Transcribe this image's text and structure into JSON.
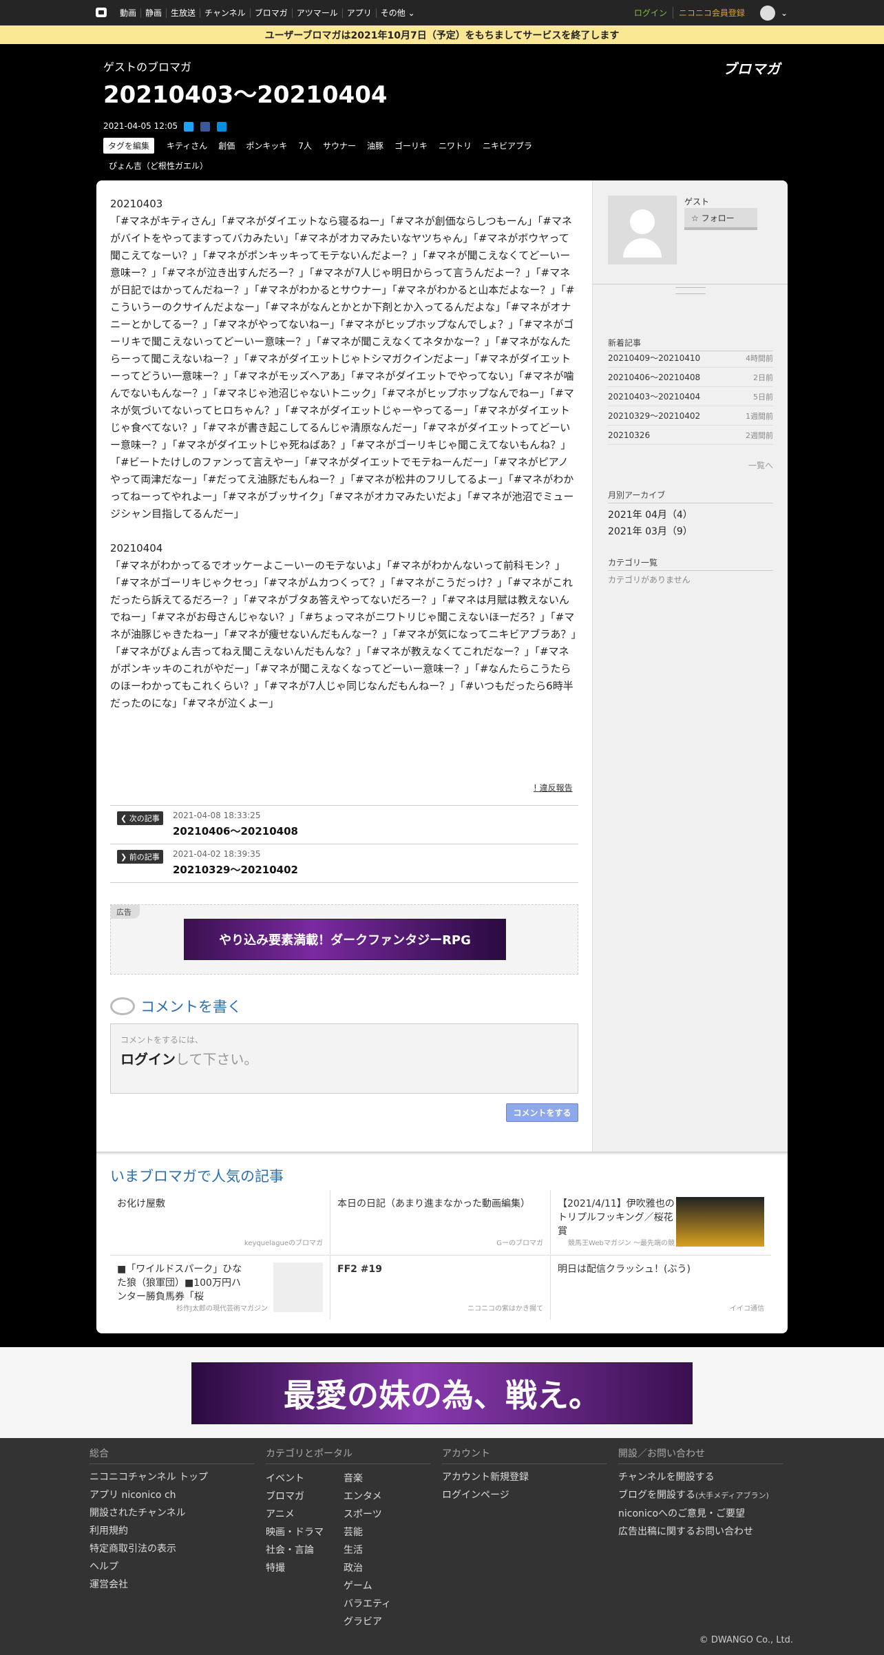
{
  "topbar": {
    "nav": [
      "動画",
      "静画",
      "生放送",
      "チャンネル",
      "ブロマガ",
      "アツマール",
      "アプリ",
      "その他"
    ],
    "login": "ログイン",
    "premium": "ニコニコ会員登録"
  },
  "notice": "ユーザーブロマガは2021年10月7日（予定）をもちましてサービスを終了します",
  "header": {
    "author": "ゲストのブロマガ",
    "title": "20210403～20210404",
    "brand": "ブロマガ",
    "date": "2021-04-05 12:05",
    "edit_tags": "タグを編集",
    "tags": [
      "キティさん",
      "創価",
      "ポンキッキ",
      "7人",
      "サウナー",
      "油豚",
      "ゴーリキ",
      "ニワトリ",
      "ニキビアブラ",
      "ぴょん吉（ど根性ガエル）"
    ]
  },
  "article": {
    "paragraphs": [
      "20210403\n「#マネがキティさん」「#マネがダイエットなら寝るねー」「#マネが創価ならしつもーん」「#マネがバイトをやってますってバカみたい」「#マネがオカマみたいなヤツちゃん」「#マネがボウヤって聞こえてなーい？」「#マネがポンキッキってモテないんだよー？」「#マネが聞こえなくてどーいー意味ー？」「#マネが泣き出すんだろー？」「#マネが7人じゃ明日からって言うんだよー？」「#マネが日記ではかってんだねー？」「#マネがわかるとサウナー」「#マネがわかると山本だよなー？」「#こういうーのクサイんだよなー」「#マネがなんとかとか下剤とか入ってるんだよな」「#マネがオナニーとかしてるー？」「#マネがやってないねー」「#マネがヒップホップなんでしょ？」「#マネがゴーリキで聞こえないってどーいー意味ー？」「#マネが聞こえなくてネタかなー？」「#マネがなんたらーって聞こえないねー？」「#マネがダイエットじゃトシマガクインだよー」「#マネがダイエットーってどうい一意味ー？」「#マネがモッズヘアあ」「#マネがダイエットでやってない」「#マネが噛んでないもんなー？」「#マネじゃ池沼じゃないトニック」「#マネがヒップホップなんでねー」「#マネが気づいてないってヒロちゃん？」「#マネがダイエットじゃーやってるー」「#マネがダイエットじゃ食べてない？」「#マネが書き起こしてるんじゃ清原なんだー」「#マネがダイエットってどーいー意味ー？」「#マネがダイエットじゃ死ねばあ？」「#マネがゴーリキじゃ聞こえてないもんね？」「#ビートたけしのファンって言えやー」「#マネがダイエットでモテねーんだー」「#マネがピアノやって両津だなー」「#だってえ油豚だもんねー？」「#マネが松井のフリしてるよー」「#マネがわかってねーってやれよー」「#マネがブッサイク」「#マネがオカマみたいだよ」「#マネが池沼でミュージシャン目指してるんだー」",
      "20210404\n「#マネがわかってるでオッケーよこーいーのモテないよ」「#マネがわかんないって前科モン？」「#マネがゴーリキじゃクセっ」「#マネがムカつくって？」「#マネがこうだっけ？」「#マネがこれだったら訴えてるだろー？」「#マネがブタあ答えやってないだろー？」「#マネは月賦は教えないんでねー」「#マネがお母さんじゃない？」「#ちょっマネがニワトリじゃ聞こえないほーだろ？」「#マネが油豚じゃきたねー」「#マネが痩せないんだもんなー？」「#マネが気になってニキビアブラあ？」「#マネがぴょん吉ってねえ聞こえないんだもんな？」「#マネが教えなくてこれだなー？」「#マネがポンキッキのこれがやだー」「#マネが聞こえなくなってどーいー意味ー？」「#なんたらこうたらのほーわかってもこれくらい？」「#マネが7人じゃ同じなんだもんねー？」「#いつもだったら6時半だったのにな」「#マネが泣くよー」"
    ],
    "report": "! 違反報告"
  },
  "pager": {
    "next_label": "次の記事",
    "next_date": "2021-04-08 18:33:25",
    "next_title": "20210406～20210408",
    "prev_label": "前の記事",
    "prev_date": "2021-04-02 18:39:35",
    "prev_title": "20210329～20210402"
  },
  "ad": {
    "label": "広告",
    "banner_text": "やり込み要素満載！ダークファンタジーRPG",
    "bottom_banner_text": "最愛の妹の為、戦え。"
  },
  "comment": {
    "heading": "コメントを書く",
    "hint": "コメントをするには、",
    "login": "ログイン",
    "login_suffix": "して下さい。",
    "submit": "コメントをする"
  },
  "sidebar": {
    "user": "ゲスト",
    "follow": "☆ フォロー",
    "recent_heading": "新着記事",
    "recent": [
      {
        "title": "20210409～20210410",
        "ago": "4時間前"
      },
      {
        "title": "20210406～20210408",
        "ago": "2日前"
      },
      {
        "title": "20210403～20210404",
        "ago": "5日前"
      },
      {
        "title": "20210329～20210402",
        "ago": "1週間前"
      },
      {
        "title": "20210326",
        "ago": "2週間前"
      }
    ],
    "more": "一覧へ",
    "archive_heading": "月別アーカイブ",
    "archive": [
      "2021年 04月（4）",
      "2021年 03月（9）"
    ],
    "category_heading": "カテゴリ一覧",
    "category_none": "カテゴリがありません"
  },
  "popular": {
    "heading": "いまブロマガで人気の記事",
    "items": [
      {
        "title": "お化け屋敷",
        "source": "keyquelagueのブロマガ"
      },
      {
        "title": "本日の日記（あまり進まなかった動画編集）",
        "source": "Gーのブロマガ"
      },
      {
        "title": "【2021/4/11】伊吹雅也のトリプルフッキング／桜花賞",
        "source": "競馬王Webマガジン ～最先端の競"
      },
      {
        "title": "■「ワイルドスパーク」ひなた狼（狼軍団）■100万円ハンター勝負馬券「桜",
        "source": "杉作J太郎の現代芸術マガジン"
      },
      {
        "title": "FF2 #19",
        "source": "ニコニコの紫はかき揚て"
      },
      {
        "title": "明日は配信クラッシュ！(ぶう)",
        "source": "イイコ通信"
      }
    ]
  },
  "footer": {
    "col1_heading": "総合",
    "col1": [
      "ニコニコチャンネル トップ",
      "アプリ niconico ch",
      "開設されたチャンネル",
      "利用規約",
      "特定商取引法の表示",
      "ヘルプ",
      "運営会社"
    ],
    "col2_heading": "カテゴリとポータル",
    "col2a": [
      "イベント",
      "ブロマガ",
      "アニメ",
      "映画・ドラマ",
      "社会・言論",
      "特撮"
    ],
    "col2b": [
      "音楽",
      "エンタメ",
      "スポーツ",
      "芸能",
      "生活",
      "政治",
      "ゲーム",
      "バラエティ",
      "グラビア"
    ],
    "col3_heading": "アカウント",
    "col3": [
      "アカウント新規登録",
      "ログインページ"
    ],
    "col4_heading": "開設／お問い合わせ",
    "col4": [
      "チャンネルを開設する",
      "ブログを開設する",
      "niconicoへのご意見・ご要望",
      "広告出稿に関するお問い合わせ"
    ],
    "col4_note": "(大手メディアブラン)",
    "copyright": "© DWANGO Co., Ltd."
  }
}
